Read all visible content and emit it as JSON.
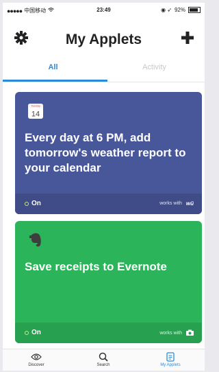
{
  "status_bar": {
    "carrier": "中国移动",
    "time": "23:49",
    "battery": "92%"
  },
  "header": {
    "title": "My Applets",
    "settings_icon": "gear-icon",
    "add_icon": "plus-icon"
  },
  "tabs": [
    {
      "label": "All",
      "active": true
    },
    {
      "label": "Activity",
      "active": false
    }
  ],
  "applets": [
    {
      "description": "Every day at 6 PM, add tomorrow's weather report to your calendar",
      "calendar_day": "14",
      "status": "On",
      "works_with": "works with",
      "service_mark": "wü",
      "color": "#48579a"
    },
    {
      "description": "Save receipts to Evernote",
      "status": "On",
      "works_with": "works with",
      "service_icon": "camera-icon",
      "color": "#2cb45a"
    }
  ],
  "bottom_nav": [
    {
      "label": "Discover",
      "icon": "eye-icon"
    },
    {
      "label": "Search",
      "icon": "search-icon"
    },
    {
      "label": "My Applets",
      "icon": "document-icon",
      "active": true
    }
  ],
  "accent_color": "#2e8ad8"
}
